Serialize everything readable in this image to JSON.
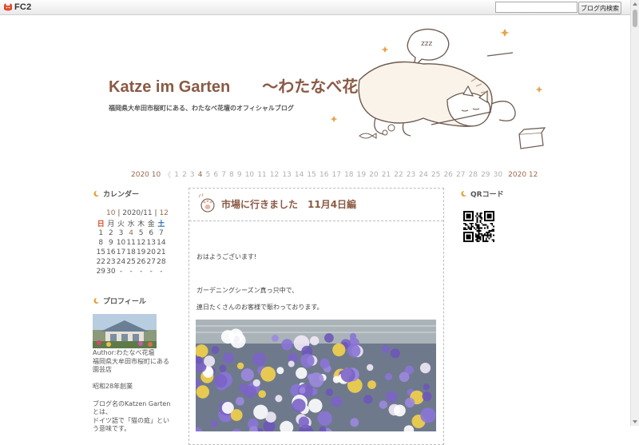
{
  "toolbar": {
    "logo_text": "FC2",
    "search_placeholder": "",
    "search_button": "ブログ内検索"
  },
  "header": {
    "title": "Katze im Garten　　〜わたなべ花壇Blog〜",
    "description": "福岡県大牟田市桜町にある、わたなべ花壇のオフィシャルブログ"
  },
  "pager": {
    "prev": "2020 10",
    "days": [
      "1",
      "2",
      "3",
      "4",
      "5",
      "6",
      "7",
      "8",
      "9",
      "10",
      "11",
      "12",
      "13",
      "14",
      "15",
      "16",
      "17",
      "18",
      "19",
      "20",
      "21",
      "22",
      "23",
      "24",
      "25",
      "26",
      "27",
      "28",
      "29",
      "30"
    ],
    "current_day": "4",
    "next": "2020 12"
  },
  "sidebar": {
    "calendar_heading": "カレンダー",
    "calendar_prev": "10",
    "calendar_current": "2020/11",
    "calendar_next": "12",
    "calendar_separator": "|",
    "weekdays": [
      "日",
      "月",
      "火",
      "水",
      "木",
      "金",
      "土"
    ],
    "weeks": [
      [
        "1",
        "2",
        "3",
        "4",
        "5",
        "6",
        "7"
      ],
      [
        "8",
        "9",
        "10",
        "11",
        "12",
        "13",
        "14"
      ],
      [
        "15",
        "16",
        "17",
        "18",
        "19",
        "20",
        "21"
      ],
      [
        "22",
        "23",
        "24",
        "25",
        "26",
        "27",
        "28"
      ],
      [
        "29",
        "30",
        "-",
        "-",
        "-",
        "-",
        "-"
      ]
    ],
    "linked_day": "4",
    "profile_heading": "プロフィール",
    "profile_lines": [
      "Author:わたなべ花壇",
      "福岡県大牟田市桜町にある園芸店",
      "",
      "昭和28年創業",
      "",
      "ブログ名のKatzen Gartenとは、",
      "ドイツ語で「猫の庭」という意味です。"
    ],
    "qr_heading": "QRコード"
  },
  "article": {
    "title": "市場に行きました　11月4日編",
    "greeting": "おはようございます!",
    "line1": "ガーデニングシーズン真っ只中で、",
    "line2": "連日たくさんのお客様で賑わっております。"
  },
  "colors": {
    "accent": "#8a5a44",
    "sunday": "#d94b2b",
    "saturday": "#2c6db5"
  }
}
